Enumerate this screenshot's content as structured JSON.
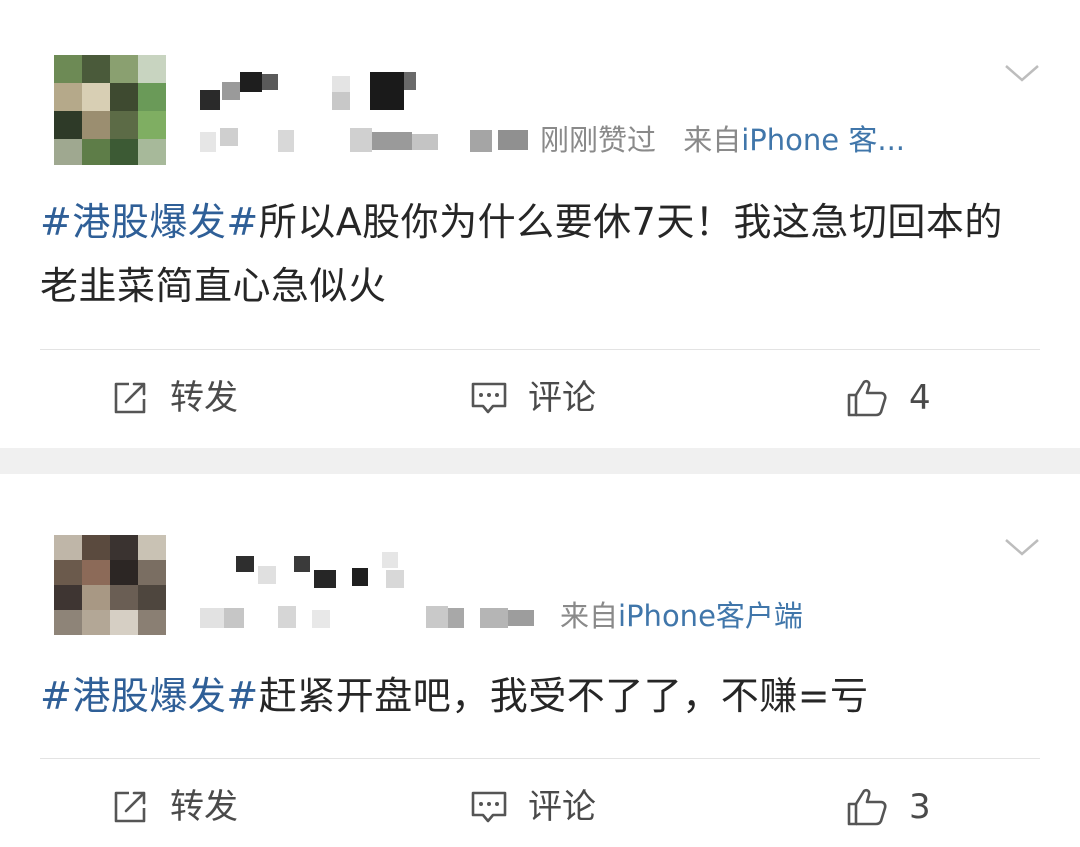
{
  "colors": {
    "hashtag": "#2f5f97",
    "source_link": "#1f5f9c",
    "meta_text": "#8a8a8a",
    "body_text": "#262626",
    "divider": "#e3e3e3",
    "feed_background": "#f0f0f0"
  },
  "posts": [
    {
      "meta_suffix": "刚刚赞过",
      "source_prefix": "来自",
      "source_app": "iPhone 客...",
      "hashtag": "#港股爆发#",
      "content": "所以A股你为什么要休7天！我这急切回本的老韭菜简直心急似火",
      "actions": {
        "repost_label": "转发",
        "comment_label": "评论",
        "like_count": "4"
      },
      "icons": [
        "repost-icon",
        "comment-icon",
        "like-icon",
        "chevron-down-icon"
      ]
    },
    {
      "meta_suffix": "",
      "source_prefix": "来自",
      "source_app": "iPhone客户端",
      "hashtag": "#港股爆发#",
      "content": "赶紧开盘吧，我受不了了，不赚=亏",
      "actions": {
        "repost_label": "转发",
        "comment_label": "评论",
        "like_count": "3"
      },
      "icons": [
        "repost-icon",
        "comment-icon",
        "like-icon",
        "chevron-down-icon"
      ]
    }
  ]
}
